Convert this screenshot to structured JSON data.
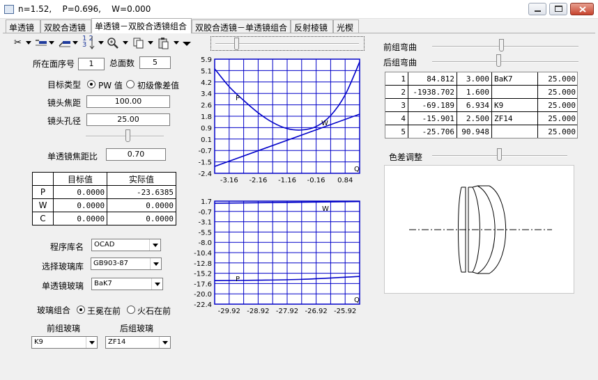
{
  "window": {
    "title": "n=1.52,    P=0.696,    W=0.000"
  },
  "tabs": [
    "单透镜",
    "双胶合透镜",
    "单透镜－双胶合透镜组合",
    "双胶合透镜－单透镜组合",
    "反射棱镜",
    "光楔"
  ],
  "active_tab": 2,
  "left": {
    "surface_no_label": "所在面序号",
    "surface_no": "1",
    "total_surfaces_label": "总面数",
    "total_surfaces": "5",
    "target_type_label": "目标类型",
    "opt_pw": "PW 值",
    "opt_primary": "初级像差值",
    "focal_label": "镜头焦距",
    "focal": "100.00",
    "aperture_label": "镜头孔径",
    "aperture": "25.00",
    "ratio_label": "单透镜焦距比",
    "ratio": "0.70",
    "table_headers": [
      "目标值",
      "实际值"
    ],
    "rows": [
      [
        "P",
        "0.0000",
        "-23.6385"
      ],
      [
        "W",
        "0.0000",
        "0.0000"
      ],
      [
        "C",
        "0.0000",
        "0.0000"
      ]
    ],
    "lib_label": "程序库名",
    "lib": "OCAD",
    "glass_lib_label": "选择玻璃库",
    "glass_lib": "GB903-87",
    "single_glass_label": "单透镜玻璃",
    "single_glass": "BaK7",
    "combo_label": "玻璃组合",
    "combo_opt1": "王冕在前",
    "combo_opt2": "火石在前",
    "front_glass_label": "前组玻璃",
    "front_glass": "K9",
    "rear_glass_label": "后组玻璃",
    "rear_glass": "ZF14"
  },
  "right": {
    "front_bend_label": "前组弯曲",
    "rear_bend_label": "后组弯曲",
    "color_label": "色差调整",
    "rows": [
      [
        "1",
        "84.812",
        "3.000",
        "BaK7",
        "25.000"
      ],
      [
        "2",
        "-1938.702",
        "1.600",
        "",
        "25.000"
      ],
      [
        "3",
        "-69.189",
        "6.934",
        "K9",
        "25.000"
      ],
      [
        "4",
        "-15.901",
        "2.500",
        "ZF14",
        "25.000"
      ],
      [
        "5",
        "-25.706",
        "90.948",
        "",
        "25.000"
      ]
    ]
  },
  "chart_data": [
    {
      "type": "line",
      "x_ticks": [
        "-3.16",
        "-2.16",
        "-1.16",
        "-0.16",
        "0.84"
      ],
      "y_ticks": [
        "5.9",
        "5.1",
        "4.2",
        "3.4",
        "2.6",
        "1.8",
        "0.9",
        "0.1",
        "-0.7",
        "-1.5",
        "-2.4"
      ],
      "xlim": [
        -3.66,
        1.34
      ],
      "ylim": [
        -2.4,
        5.9
      ],
      "grid": true,
      "axis_end_label": "Q",
      "series": [
        {
          "name": "P",
          "x": [
            -3.66,
            -3.16,
            -2.66,
            -2.16,
            -1.66,
            -1.16,
            -0.66,
            -0.16,
            0.34,
            0.84,
            1.34
          ],
          "y": [
            5.2,
            3.9,
            2.9,
            2.0,
            1.3,
            0.85,
            0.75,
            1.0,
            1.8,
            3.3,
            5.7
          ]
        },
        {
          "name": "W",
          "x": [
            -3.66,
            1.34
          ],
          "y": [
            -1.9,
            1.9
          ]
        }
      ]
    },
    {
      "type": "line",
      "x_ticks": [
        "-29.92",
        "-28.92",
        "-27.92",
        "-26.92",
        "-25.92"
      ],
      "y_ticks": [
        "1.7",
        "-0.7",
        "-3.1",
        "-5.5",
        "-8.0",
        "-10.4",
        "-12.8",
        "-15.2",
        "-17.6",
        "-20.0",
        "-22.4"
      ],
      "xlim": [
        -30.42,
        -25.42
      ],
      "ylim": [
        -22.4,
        1.7
      ],
      "grid": true,
      "axis_end_label": "Q",
      "series": [
        {
          "name": "W",
          "x": [
            -30.42,
            -25.42
          ],
          "y": [
            1.2,
            1.6
          ]
        },
        {
          "name": "P",
          "x": [
            -30.42,
            -28.92,
            -27.42,
            -25.92,
            -25.42
          ],
          "y": [
            -16.9,
            -16.8,
            -16.6,
            -16.1,
            -15.9
          ]
        }
      ]
    }
  ]
}
